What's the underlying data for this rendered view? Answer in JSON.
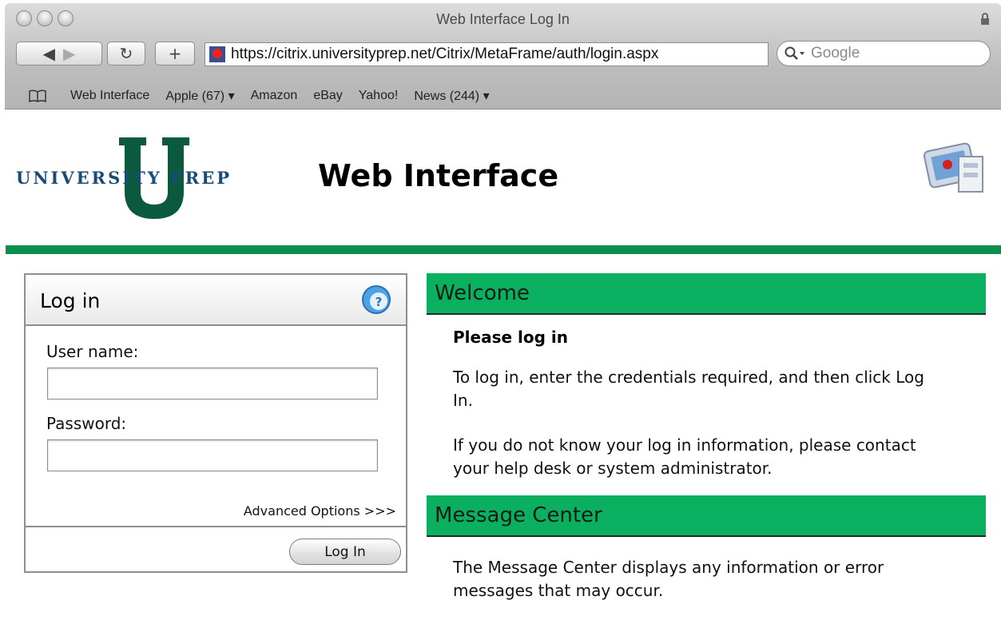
{
  "browser": {
    "window_title": "Web Interface Log In",
    "url": "https://citrix.universityprep.net/Citrix/MetaFrame/auth/login.aspx",
    "search_placeholder": "Google",
    "bookmarks": [
      "Web Interface",
      "Apple (67) ▾",
      "Amazon",
      "eBay",
      "Yahoo!",
      "News (244) ▾"
    ],
    "icons": {
      "back": "back-arrow-icon",
      "forward": "forward-arrow-icon",
      "reload": "reload-icon",
      "add_bookmark": "plus-icon",
      "bookmarks": "book-icon",
      "lock": "lock-icon",
      "site": "site-favicon"
    }
  },
  "header": {
    "logo_text": "UNIVERSITY PREP",
    "logo_letter": "U",
    "title": "Web Interface"
  },
  "login": {
    "title": "Log in",
    "username_label": "User name:",
    "username_value": "",
    "password_label": "Password:",
    "password_value": "",
    "advanced_options": "Advanced Options >>>",
    "login_button": "Log In"
  },
  "welcome": {
    "title": "Welcome",
    "heading": "Please log in",
    "paragraph1": "To log in, enter the credentials required, and then click Log In.",
    "paragraph2": "If you do not know your log in information, please contact your help desk or system administrator."
  },
  "message_center": {
    "title": "Message Center",
    "paragraph": "The Message Center displays any information or error messages that may occur."
  },
  "colors": {
    "green_rule": "#0a8f4f",
    "panel_green": "#0ab060",
    "logo_green": "#0b5a3e",
    "logo_blue": "#1a4a78"
  }
}
